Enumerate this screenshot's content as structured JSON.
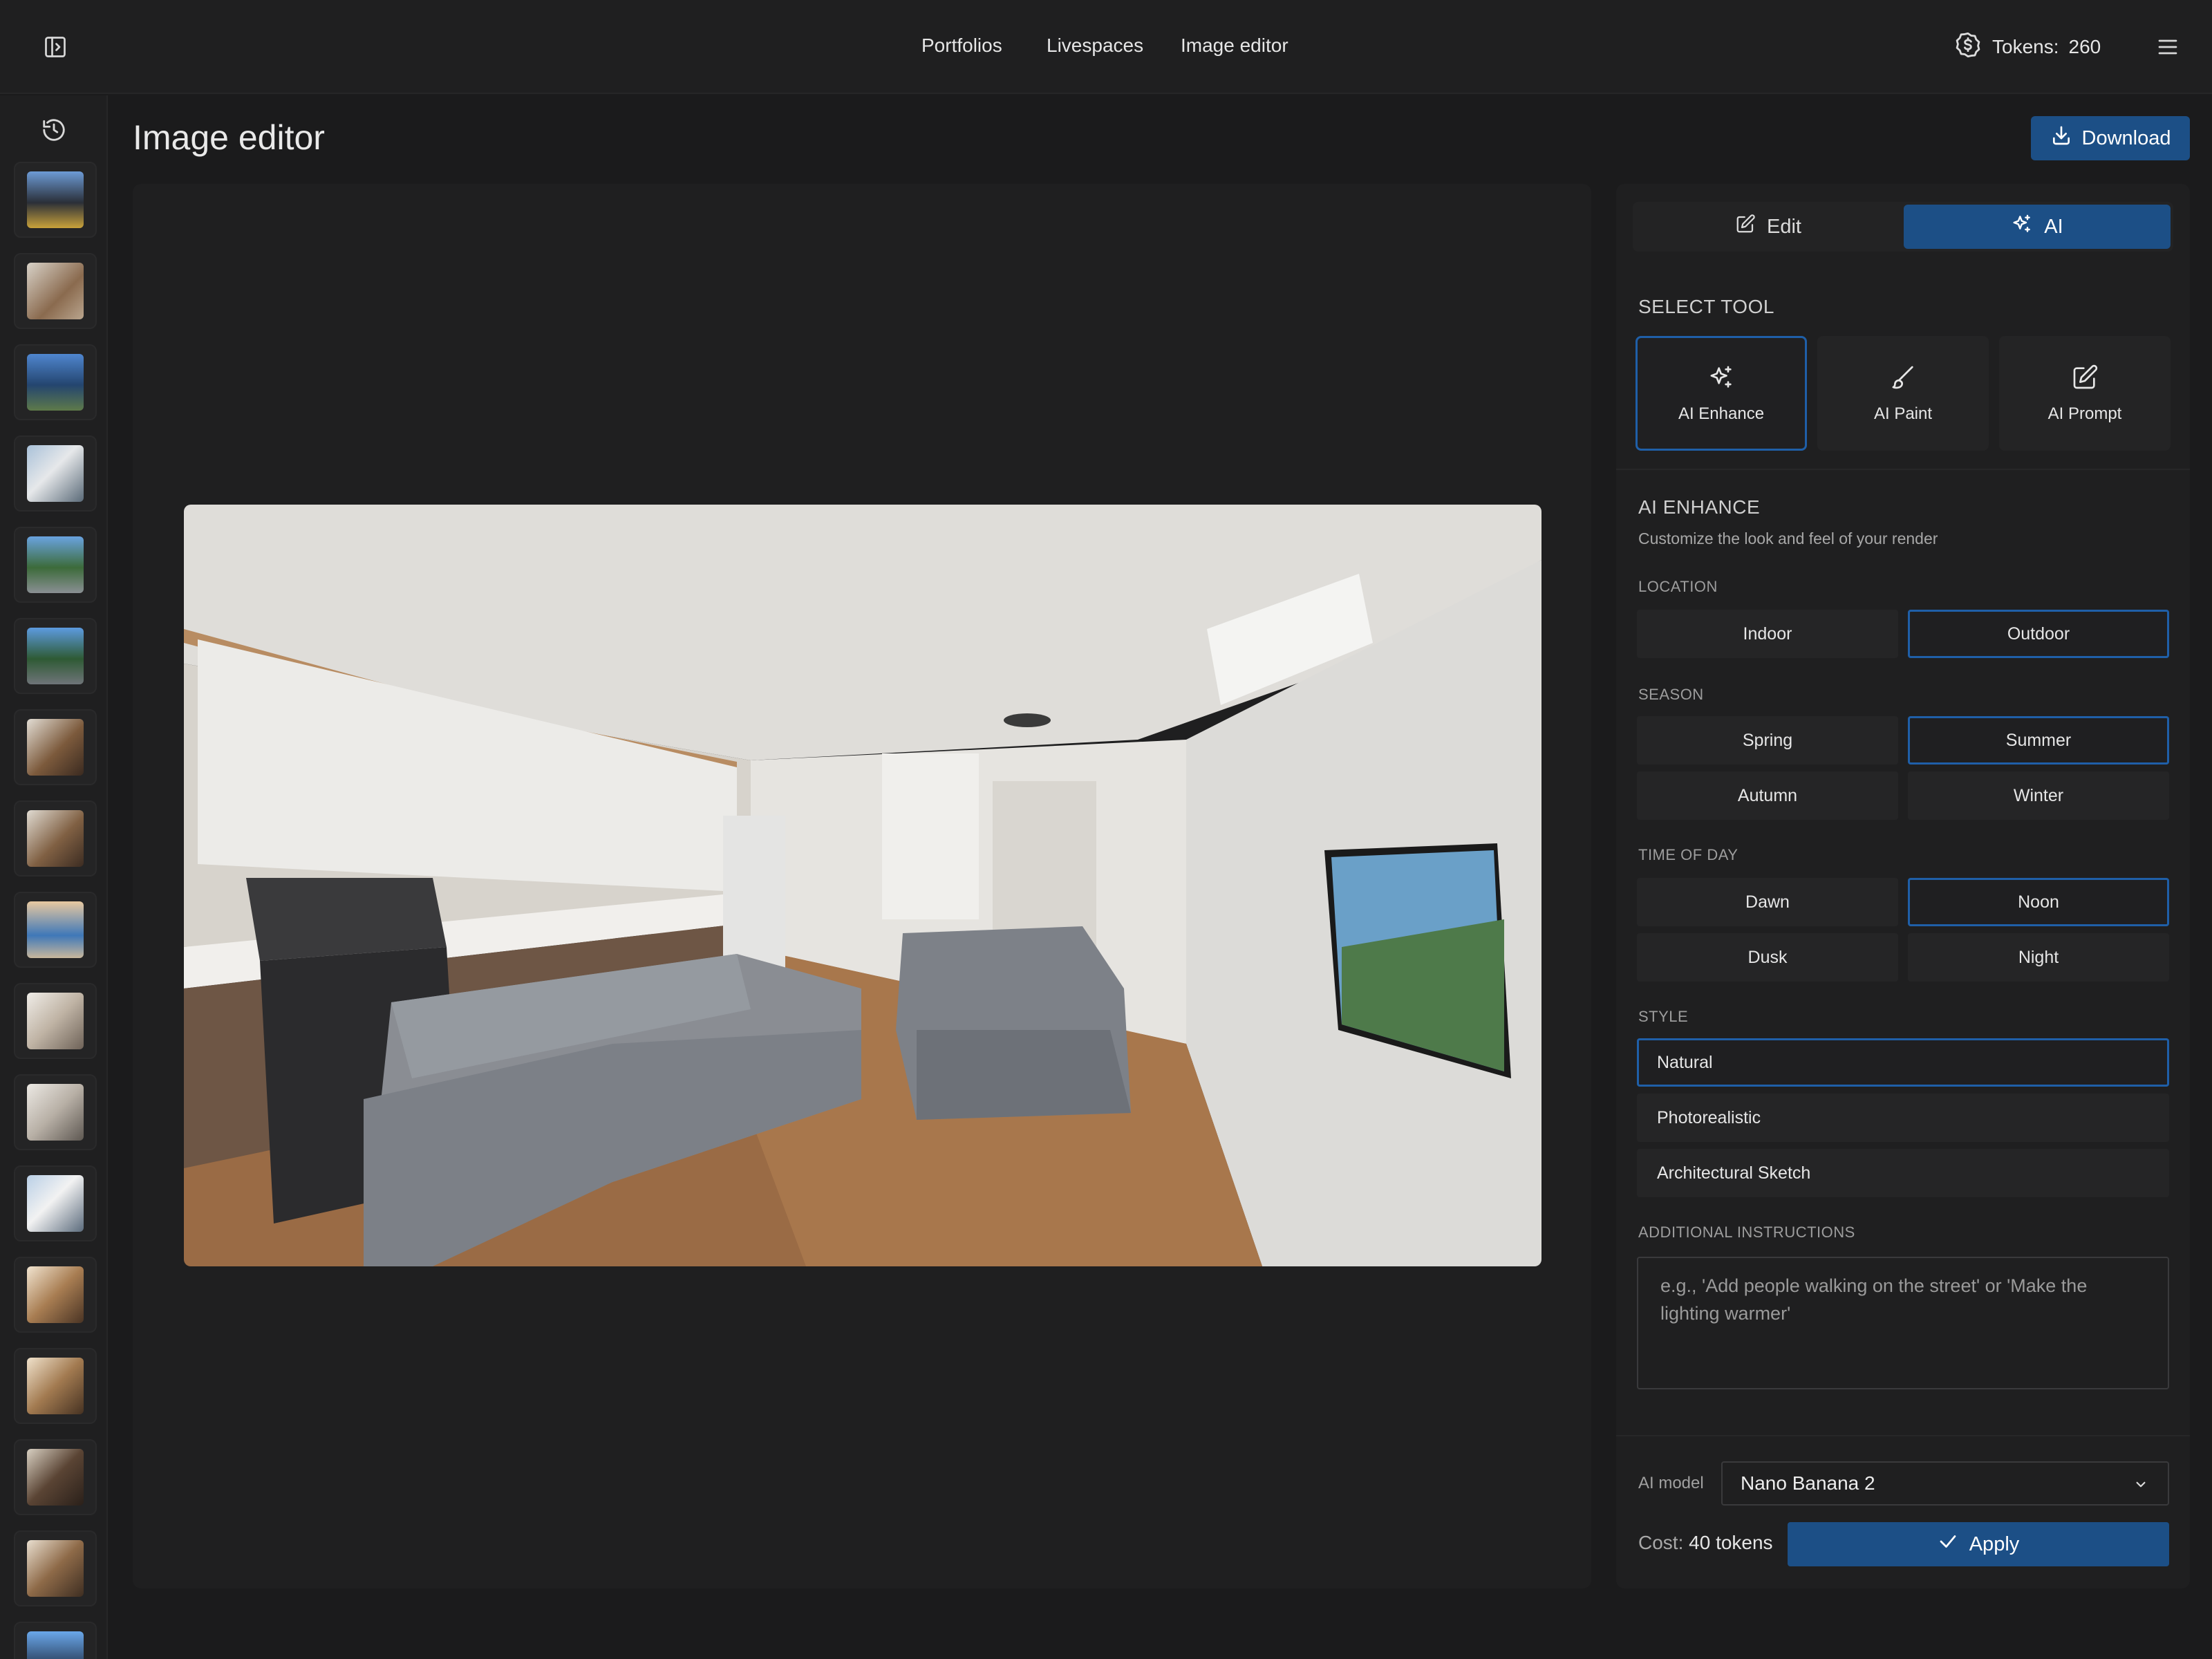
{
  "nav": {
    "links": [
      "Portfolios",
      "Livespaces",
      "Image editor"
    ],
    "tokens_label": "Tokens:",
    "tokens_value": "260"
  },
  "page": {
    "title": "Image editor",
    "download_label": "Download"
  },
  "panel": {
    "mode_tabs": [
      "Edit",
      "AI"
    ],
    "active_mode": "AI",
    "select_tool_heading": "SELECT TOOL",
    "tools": [
      "AI Enhance",
      "AI Paint",
      "AI Prompt"
    ],
    "active_tool": "AI Enhance",
    "enhance_heading": "AI ENHANCE",
    "enhance_desc": "Customize the look and feel of your render",
    "location_label": "LOCATION",
    "location_options": [
      "Indoor",
      "Outdoor"
    ],
    "location_selected": "Outdoor",
    "season_label": "SEASON",
    "season_options": [
      "Spring",
      "Summer",
      "Autumn",
      "Winter"
    ],
    "season_selected": "Summer",
    "time_label": "TIME OF DAY",
    "time_options": [
      "Dawn",
      "Noon",
      "Dusk",
      "Night"
    ],
    "time_selected": "Noon",
    "style_label": "STYLE",
    "style_options": [
      "Natural",
      "Photorealistic",
      "Architectural Sketch"
    ],
    "style_selected": "Natural",
    "instructions_label": "ADDITIONAL INSTRUCTIONS",
    "instructions_placeholder": "e.g., 'Add people walking on the street' or 'Make the lighting warmer'",
    "model_label": "AI model",
    "model_value": "Nano Banana 2",
    "cost_label": "Cost:",
    "cost_value": "40 tokens",
    "apply_label": "Apply"
  },
  "colors": {
    "accent": "#1c4f86",
    "accent_border": "#1f5fa8",
    "background": "#1b1b1c",
    "surface": "#1f1f20"
  }
}
